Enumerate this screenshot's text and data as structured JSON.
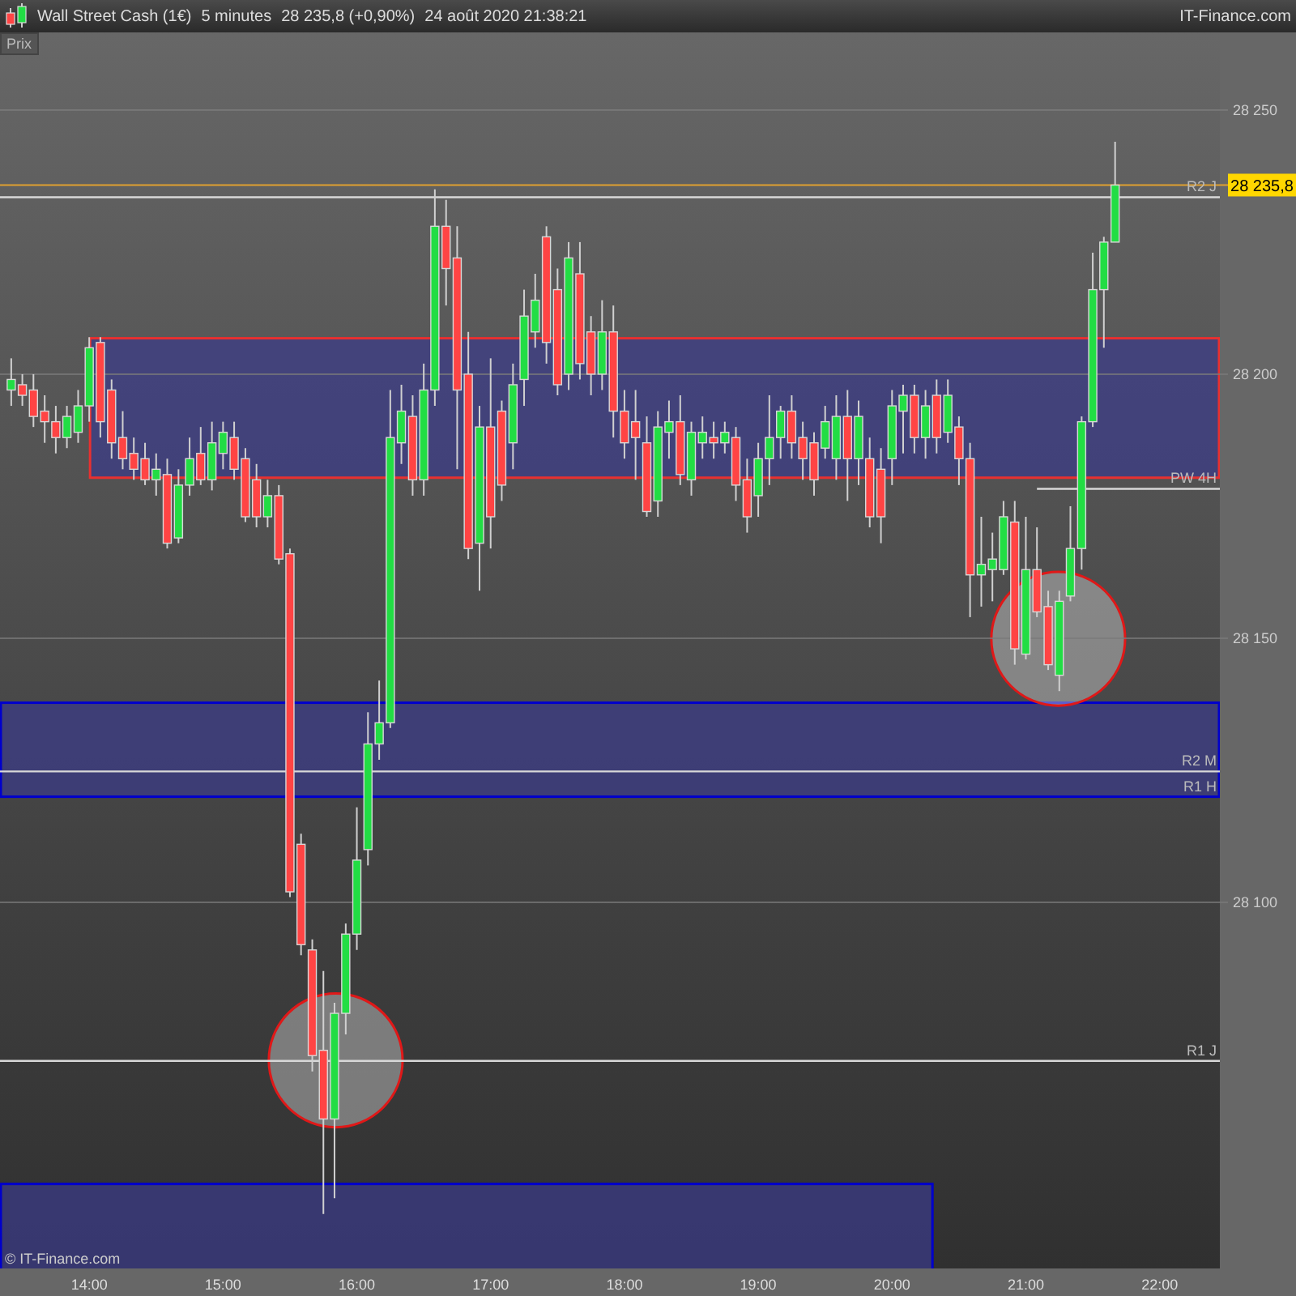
{
  "title_bar": {
    "instrument": "Wall Street Cash (1€)",
    "interval": "5 minutes",
    "quote": "28 235,8 (+0,90%)",
    "timestamp": "24 août 2020 21:38:21",
    "site": "IT-Finance.com"
  },
  "chart": {
    "axis_title": "Prix",
    "copyright": "© IT-Finance.com",
    "level_labels": [
      "R2 J",
      "PW 4H",
      "R2 M",
      "R1 H",
      "R1 J"
    ],
    "price_tag": "28 235,8",
    "chart_data": {
      "type": "candlestick",
      "grid": true,
      "xlim": [
        13.333,
        22.45
      ],
      "ylim": [
        28030.7,
        28264.7
      ],
      "yticks": [
        {
          "value": 28100,
          "label": "28 100"
        },
        {
          "value": 28150,
          "label": "28 150"
        },
        {
          "value": 28200,
          "label": "28 200"
        },
        {
          "value": 28250,
          "label": "28 250"
        }
      ],
      "xticks": [
        {
          "value": 14,
          "label": "14:00"
        },
        {
          "value": 15,
          "label": "15:00"
        },
        {
          "value": 16,
          "label": "16:00"
        },
        {
          "value": 17,
          "label": "17:00"
        },
        {
          "value": 18,
          "label": "18:00"
        },
        {
          "value": 19,
          "label": "19:00"
        },
        {
          "value": 20,
          "label": "20:00"
        },
        {
          "value": 21,
          "label": "21:00"
        },
        {
          "value": 22,
          "label": "22:00"
        }
      ],
      "x": [
        13.417,
        13.5,
        13.583,
        13.667,
        13.75,
        13.833,
        13.917,
        14,
        14.083,
        14.167,
        14.25,
        14.333,
        14.417,
        14.5,
        14.583,
        14.667,
        14.75,
        14.833,
        14.917,
        15,
        15.083,
        15.167,
        15.25,
        15.333,
        15.417,
        15.5,
        15.583,
        15.667,
        15.75,
        15.833,
        15.917,
        16,
        16.083,
        16.167,
        16.25,
        16.333,
        16.417,
        16.5,
        16.583,
        16.667,
        16.75,
        16.833,
        16.917,
        17,
        17.083,
        17.167,
        17.25,
        17.333,
        17.417,
        17.5,
        17.583,
        17.667,
        17.75,
        17.833,
        17.917,
        18,
        18.083,
        18.167,
        18.25,
        18.333,
        18.417,
        18.5,
        18.583,
        18.667,
        18.75,
        18.833,
        18.917,
        19,
        19.083,
        19.167,
        19.25,
        19.333,
        19.417,
        19.5,
        19.583,
        19.667,
        19.75,
        19.833,
        19.917,
        20,
        20.083,
        20.167,
        20.25,
        20.333,
        20.417,
        20.5,
        20.583,
        20.667,
        20.75,
        20.833,
        20.917,
        21,
        21.083,
        21.167,
        21.25,
        21.333,
        21.417,
        21.5,
        21.583,
        21.667
      ],
      "ohlc": [
        [
          28197,
          28203,
          28194,
          28199
        ],
        [
          28198,
          28200,
          28194,
          28196
        ],
        [
          28197,
          28200,
          28190,
          28192
        ],
        [
          28193,
          28196,
          28187,
          28191
        ],
        [
          28191,
          28194,
          28185,
          28188
        ],
        [
          28188,
          28194,
          28186,
          28192
        ],
        [
          28189,
          28197,
          28187,
          28194
        ],
        [
          28194,
          28207,
          28191,
          28205
        ],
        [
          28206,
          28207,
          28188,
          28191
        ],
        [
          28197,
          28199,
          28184,
          28187
        ],
        [
          28188,
          28193,
          28182,
          28184
        ],
        [
          28185,
          28188,
          28180,
          28182
        ],
        [
          28184,
          28187,
          28179,
          28180
        ],
        [
          28180,
          28185,
          28177,
          28182
        ],
        [
          28181,
          28184,
          28167,
          28168
        ],
        [
          28169,
          28182,
          28168,
          28179
        ],
        [
          28179,
          28188,
          28177,
          28184
        ],
        [
          28185,
          28190,
          28179,
          28180
        ],
        [
          28180,
          28191,
          28178,
          28187
        ],
        [
          28185,
          28191,
          28182,
          28189
        ],
        [
          28188,
          28191,
          28180,
          28182
        ],
        [
          28184,
          28186,
          28172,
          28173
        ],
        [
          28180,
          28183,
          28171,
          28173
        ],
        [
          28173,
          28180,
          28171,
          28177
        ],
        [
          28177,
          28179,
          28164,
          28165
        ],
        [
          28166,
          28167,
          28101,
          28102
        ],
        [
          28111,
          28113,
          28090,
          28092
        ],
        [
          28091,
          28093,
          28068,
          28071
        ],
        [
          28072,
          28087,
          28041,
          28059
        ],
        [
          28059,
          28081,
          28044,
          28079
        ],
        [
          28079,
          28096,
          28075,
          28094
        ],
        [
          28094,
          28118,
          28091,
          28108
        ],
        [
          28110,
          28136,
          28107,
          28130
        ],
        [
          28130,
          28142,
          28127,
          28134
        ],
        [
          28134,
          28197,
          28133,
          28188
        ],
        [
          28187,
          28198,
          28183,
          28193
        ],
        [
          28192,
          28196,
          28177,
          28180
        ],
        [
          28180,
          28202,
          28177,
          28197
        ],
        [
          28197,
          28235,
          28194,
          28228
        ],
        [
          28228,
          28233,
          28213,
          28220
        ],
        [
          28222,
          28228,
          28182,
          28197
        ],
        [
          28200,
          28208,
          28165,
          28167
        ],
        [
          28168,
          28194,
          28159,
          28190
        ],
        [
          28190,
          28203,
          28167,
          28173
        ],
        [
          28193,
          28195,
          28176,
          28179
        ],
        [
          28187,
          28202,
          28182,
          28198
        ],
        [
          28199,
          28216,
          28194,
          28211
        ],
        [
          28208,
          28219,
          28205,
          28214
        ],
        [
          28226,
          28228,
          28202,
          28206
        ],
        [
          28216,
          28220,
          28196,
          28198
        ],
        [
          28200,
          28225,
          28197,
          28222
        ],
        [
          28219,
          28225,
          28199,
          28202
        ],
        [
          28208,
          28211,
          28196,
          28200
        ],
        [
          28200,
          28214,
          28197,
          28208
        ],
        [
          28208,
          28213,
          28188,
          28193
        ],
        [
          28193,
          28197,
          28184,
          28187
        ],
        [
          28191,
          28197,
          28180,
          28188
        ],
        [
          28187,
          28192,
          28173,
          28174
        ],
        [
          28176,
          28193,
          28173,
          28190
        ],
        [
          28189,
          28195,
          28184,
          28191
        ],
        [
          28191,
          28196,
          28179,
          28181
        ],
        [
          28180,
          28191,
          28177,
          28189
        ],
        [
          28187,
          28192,
          28184,
          28189
        ],
        [
          28188,
          28191,
          28184,
          28187
        ],
        [
          28187,
          28191,
          28185,
          28189
        ],
        [
          28188,
          28190,
          28176,
          28179
        ],
        [
          28180,
          28184,
          28170,
          28173
        ],
        [
          28177,
          28187,
          28173,
          28184
        ],
        [
          28184,
          28196,
          28179,
          28188
        ],
        [
          28188,
          28194,
          28184,
          28193
        ],
        [
          28193,
          28196,
          28184,
          28187
        ],
        [
          28188,
          28191,
          28180,
          28184
        ],
        [
          28187,
          28189,
          28177,
          28180
        ],
        [
          28186,
          28194,
          28184,
          28191
        ],
        [
          28184,
          28196,
          28180,
          28192
        ],
        [
          28192,
          28197,
          28176,
          28184
        ],
        [
          28184,
          28195,
          28179,
          28192
        ],
        [
          28184,
          28188,
          28171,
          28173
        ],
        [
          28182,
          28186,
          28168,
          28173
        ],
        [
          28184,
          28197,
          28179,
          28194
        ],
        [
          28193,
          28198,
          28185,
          28196
        ],
        [
          28196,
          28198,
          28185,
          28188
        ],
        [
          28188,
          28197,
          28184,
          28194
        ],
        [
          28196,
          28199,
          28185,
          28188
        ],
        [
          28189,
          28199,
          28187,
          28196
        ],
        [
          28190,
          28192,
          28179,
          28184
        ],
        [
          28184,
          28187,
          28154,
          28162
        ],
        [
          28162,
          28173,
          28156,
          28164
        ],
        [
          28163,
          28170,
          28157,
          28165
        ],
        [
          28163,
          28176,
          28162,
          28173
        ],
        [
          28172,
          28176,
          28145,
          28148
        ],
        [
          28147,
          28173,
          28146,
          28163
        ],
        [
          28163,
          28171,
          28154,
          28155
        ],
        [
          28156,
          28159,
          28144,
          28145
        ],
        [
          28143,
          28159,
          28140,
          28157
        ],
        [
          28158,
          28175,
          28157,
          28167
        ],
        [
          28167,
          28192,
          28163,
          28191
        ],
        [
          28191,
          28223,
          28190,
          28216
        ],
        [
          28216,
          28226,
          28205,
          28225
        ],
        [
          28225,
          28244,
          28225,
          28235.8
        ]
      ]
    }
  }
}
